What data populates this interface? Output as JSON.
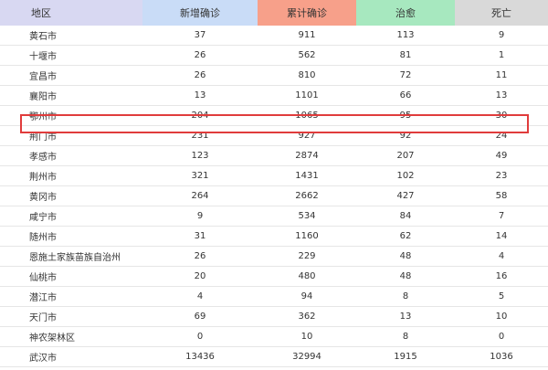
{
  "header": {
    "region": "地区",
    "new_confirmed": "新增确诊",
    "total_confirmed": "累计确诊",
    "cured": "治愈",
    "deaths": "死亡"
  },
  "colors": {
    "region_header_bg": "#d8d8f2",
    "new_confirmed_header_bg": "#c9dcf7",
    "total_confirmed_header_bg": "#f7a08a",
    "cured_header_bg": "#a7e8bf",
    "deaths_header_bg": "#d9d9d9",
    "highlight_border": "#e03c3c"
  },
  "rows": [
    {
      "region": "黄石市",
      "new": "37",
      "total": "911",
      "cured": "113",
      "deaths": "9"
    },
    {
      "region": "十堰市",
      "new": "26",
      "total": "562",
      "cured": "81",
      "deaths": "1"
    },
    {
      "region": "宜昌市",
      "new": "26",
      "total": "810",
      "cured": "72",
      "deaths": "11"
    },
    {
      "region": "襄阳市",
      "new": "13",
      "total": "1101",
      "cured": "66",
      "deaths": "13"
    },
    {
      "region": "鄂州市",
      "new": "204",
      "total": "1065",
      "cured": "95",
      "deaths": "30"
    },
    {
      "region": "荆门市",
      "new": "231",
      "total": "927",
      "cured": "92",
      "deaths": "24"
    },
    {
      "region": "孝感市",
      "new": "123",
      "total": "2874",
      "cured": "207",
      "deaths": "49"
    },
    {
      "region": "荆州市",
      "new": "321",
      "total": "1431",
      "cured": "102",
      "deaths": "23"
    },
    {
      "region": "黄冈市",
      "new": "264",
      "total": "2662",
      "cured": "427",
      "deaths": "58"
    },
    {
      "region": "咸宁市",
      "new": "9",
      "total": "534",
      "cured": "84",
      "deaths": "7"
    },
    {
      "region": "随州市",
      "new": "31",
      "total": "1160",
      "cured": "62",
      "deaths": "14"
    },
    {
      "region": "恩施土家族苗族自治州",
      "new": "26",
      "total": "229",
      "cured": "48",
      "deaths": "4"
    },
    {
      "region": "仙桃市",
      "new": "20",
      "total": "480",
      "cured": "48",
      "deaths": "16"
    },
    {
      "region": "潜江市",
      "new": "4",
      "total": "94",
      "cured": "8",
      "deaths": "5"
    },
    {
      "region": "天门市",
      "new": "69",
      "total": "362",
      "cured": "13",
      "deaths": "10"
    },
    {
      "region": "神农架林区",
      "new": "0",
      "total": "10",
      "cured": "8",
      "deaths": "0"
    },
    {
      "region": "武汉市",
      "new": "13436",
      "total": "32994",
      "cured": "1915",
      "deaths": "1036"
    }
  ]
}
